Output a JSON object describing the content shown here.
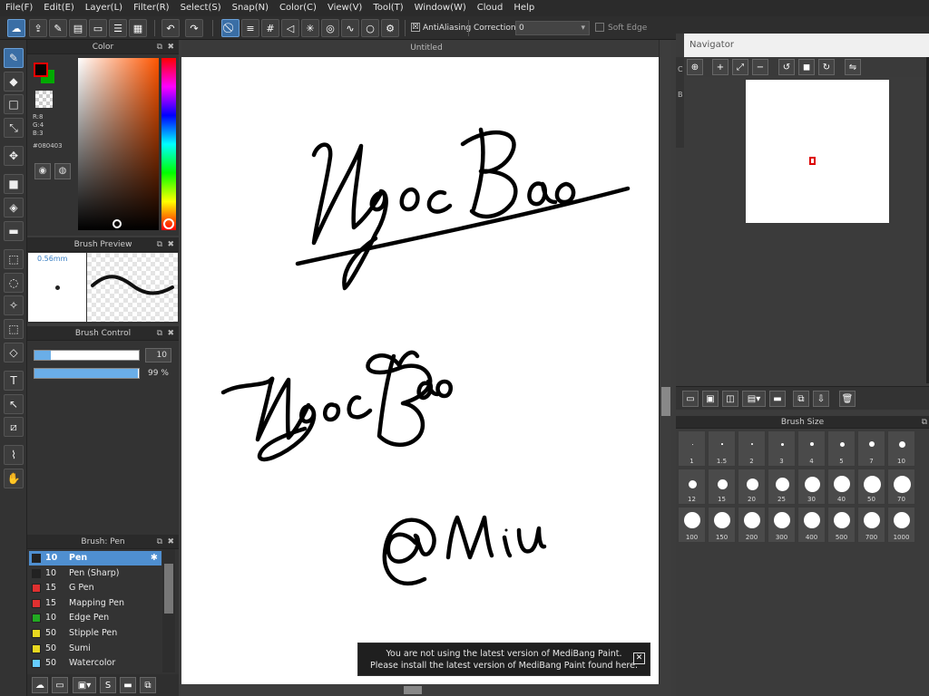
{
  "menu": [
    "File(F)",
    "Edit(E)",
    "Layer(L)",
    "Filter(R)",
    "Select(S)",
    "Snap(N)",
    "Color(C)",
    "View(V)",
    "Tool(T)",
    "Window(W)",
    "Cloud",
    "Help"
  ],
  "toolbar": {
    "antialiasing_label": "AntiAliasing",
    "antialiasing_checked": "☒",
    "correction_label": "Correction",
    "correction_value": "0",
    "soft_edge_label": "Soft Edge"
  },
  "color_panel": {
    "title": "Color",
    "r": "R:8",
    "g": "G:4",
    "b": "B:3",
    "hex": "#080403",
    "foreground": "#080403",
    "background": "#00aa00"
  },
  "brush_preview": {
    "title": "Brush Preview",
    "size": "0.56mm"
  },
  "brush_control": {
    "title": "Brush Control",
    "size_value": "10",
    "opacity_value": "99 %",
    "size_fraction": 0.16,
    "opacity_fraction": 0.99
  },
  "brush_list": {
    "title": "Brush: Pen",
    "items": [
      {
        "size": "10",
        "name": "Pen",
        "color": "#222222",
        "selected": true
      },
      {
        "size": "10",
        "name": "Pen (Sharp)",
        "color": "#222222"
      },
      {
        "size": "15",
        "name": "G Pen",
        "color": "#e03030"
      },
      {
        "size": "15",
        "name": "Mapping Pen",
        "color": "#e03030"
      },
      {
        "size": "10",
        "name": "Edge Pen",
        "color": "#22aa22"
      },
      {
        "size": "50",
        "name": "Stipple Pen",
        "color": "#e8d820"
      },
      {
        "size": "50",
        "name": "Sumi",
        "color": "#e8d820"
      },
      {
        "size": "50",
        "name": "Watercolor",
        "color": "#66ccff"
      }
    ]
  },
  "canvas": {
    "title": "Untitled"
  },
  "notification": {
    "line1": "You are not using the latest version of MediBang Paint.",
    "line2": "Please install the latest version of MediBang Paint found here.",
    "close": "✕"
  },
  "navigator": {
    "title": "Navigator"
  },
  "brush_size": {
    "title": "Brush Size",
    "sizes": [
      "1",
      "1.5",
      "2",
      "3",
      "4",
      "5",
      "7",
      "10",
      "12",
      "15",
      "20",
      "25",
      "30",
      "40",
      "50",
      "70",
      "100",
      "150",
      "200",
      "300",
      "400",
      "500",
      "700",
      "1000"
    ]
  }
}
